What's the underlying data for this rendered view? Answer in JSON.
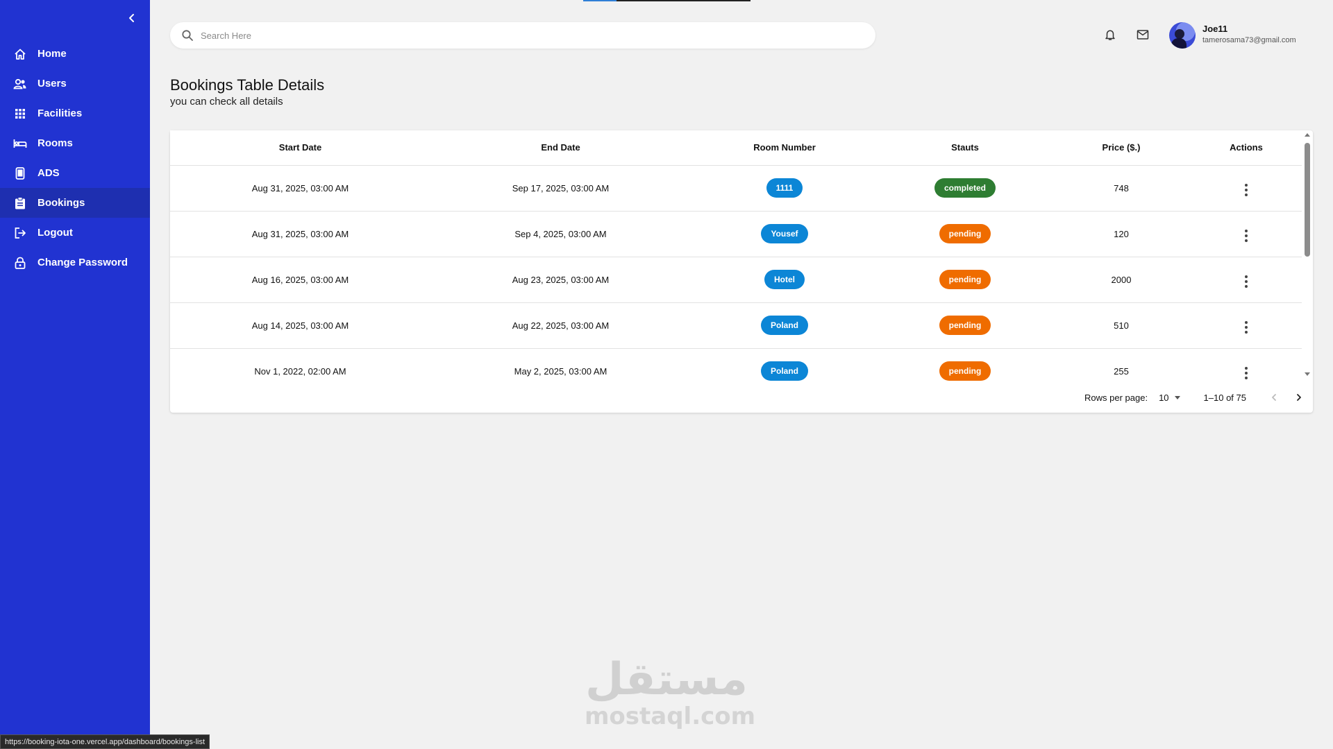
{
  "sidebar": {
    "items": [
      {
        "label": "Home",
        "icon": "home-icon"
      },
      {
        "label": "Users",
        "icon": "users-icon"
      },
      {
        "label": "Facilities",
        "icon": "grid-icon"
      },
      {
        "label": "Rooms",
        "icon": "bed-icon"
      },
      {
        "label": "ADS",
        "icon": "phone-icon"
      },
      {
        "label": "Bookings",
        "icon": "clipboard-icon",
        "active": true
      },
      {
        "label": "Logout",
        "icon": "logout-icon"
      },
      {
        "label": "Change Password",
        "icon": "lock-icon"
      }
    ],
    "background": "#2133d1"
  },
  "header": {
    "search_placeholder": "Search Here",
    "user": {
      "name": "Joe11",
      "email": "tamerosama73@gmail.com"
    }
  },
  "page": {
    "title": "Bookings Table Details",
    "subtitle": "you can check all details"
  },
  "table": {
    "columns": [
      "Start Date",
      "End Date",
      "Room Number",
      "Stauts",
      "Price ($.)",
      "Actions"
    ],
    "rows": [
      {
        "start": "Aug 31, 2025, 03:00 AM",
        "end": "Sep 17, 2025, 03:00 AM",
        "room": "1111",
        "status": "completed",
        "price": "748"
      },
      {
        "start": "Aug 31, 2025, 03:00 AM",
        "end": "Sep 4, 2025, 03:00 AM",
        "room": "Yousef",
        "status": "pending",
        "price": "120"
      },
      {
        "start": "Aug 16, 2025, 03:00 AM",
        "end": "Aug 23, 2025, 03:00 AM",
        "room": "Hotel",
        "status": "pending",
        "price": "2000"
      },
      {
        "start": "Aug 14, 2025, 03:00 AM",
        "end": "Aug 22, 2025, 03:00 AM",
        "room": "Poland",
        "status": "pending",
        "price": "510"
      },
      {
        "start": "Nov 1, 2022, 02:00 AM",
        "end": "May 2, 2025, 03:00 AM",
        "room": "Poland",
        "status": "pending",
        "price": "255"
      }
    ],
    "status_colors": {
      "completed": "#2e7d32",
      "pending": "#ef6c00"
    },
    "room_chip_color": "#0c86d6"
  },
  "pagination": {
    "rows_per_page_label": "Rows per page:",
    "rows_per_page": "10",
    "range": "1–10 of 75"
  },
  "watermark": {
    "arabic": "مستقل",
    "latin": "mostaql.com"
  },
  "status_bar_url": "https://booking-iota-one.vercel.app/dashboard/bookings-list"
}
